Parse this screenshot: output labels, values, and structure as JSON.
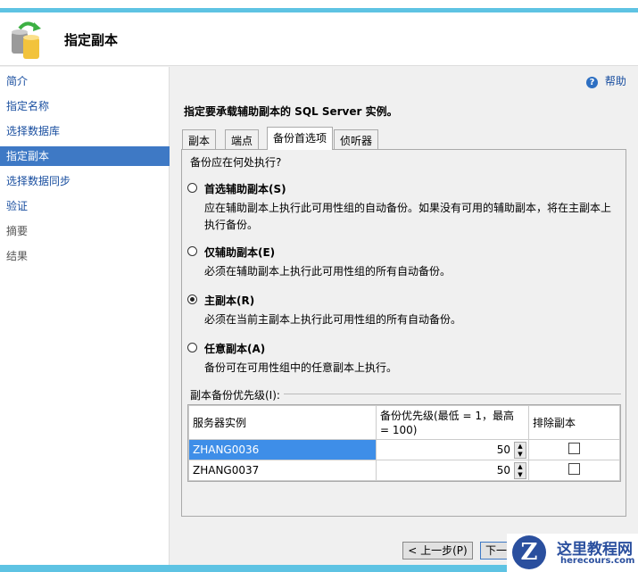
{
  "header": {
    "title": "指定副本"
  },
  "sidebar": {
    "items": [
      {
        "label": "简介",
        "state": "link"
      },
      {
        "label": "指定名称",
        "state": "link"
      },
      {
        "label": "选择数据库",
        "state": "link"
      },
      {
        "label": "指定副本",
        "state": "selected"
      },
      {
        "label": "选择数据同步",
        "state": "link"
      },
      {
        "label": "验证",
        "state": "link"
      },
      {
        "label": "摘要",
        "state": "disabled"
      },
      {
        "label": "结果",
        "state": "disabled"
      }
    ]
  },
  "help": {
    "label": "帮助"
  },
  "main": {
    "instruction": "指定要承载辅助副本的 SQL Server 实例。",
    "tabs": [
      "副本",
      "端点",
      "备份首选项",
      "侦听器"
    ],
    "question": "备份应在何处执行?",
    "options": [
      {
        "label": "首选辅助副本(S)",
        "desc": "应在辅助副本上执行此可用性组的自动备份。如果没有可用的辅助副本，将在主副本上执行备份。",
        "checked": false
      },
      {
        "label": "仅辅助副本(E)",
        "desc": "必须在辅助副本上执行此可用性组的所有自动备份。",
        "checked": false
      },
      {
        "label": "主副本(R)",
        "desc": "必须在当前主副本上执行此可用性组的所有自动备份。",
        "checked": true
      },
      {
        "label": "任意副本(A)",
        "desc": "备份可在可用性组中的任意副本上执行。",
        "checked": false
      }
    ],
    "priority_label": "副本备份优先级(I):",
    "table": {
      "headers": [
        "服务器实例",
        "备份优先级(最低 = 1，最高 = 100)",
        "排除副本"
      ],
      "rows": [
        {
          "server": "ZHANG0036",
          "priority": "50",
          "exclude": false
        },
        {
          "server": "ZHANG0037",
          "priority": "50",
          "exclude": false
        }
      ]
    }
  },
  "footer": {
    "prev": "< 上一步(P)",
    "next": "下一"
  },
  "watermark": {
    "title": "这里教程网",
    "url": "herecours.com"
  }
}
